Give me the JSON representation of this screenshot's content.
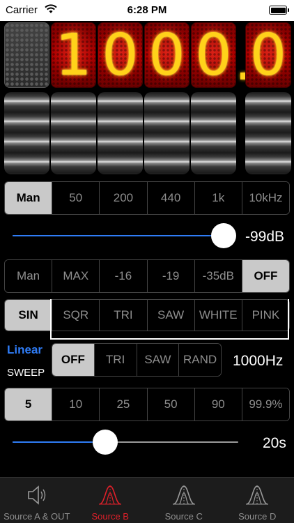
{
  "status": {
    "carrier": "Carrier",
    "time": "6:28 PM"
  },
  "display": {
    "digits": [
      "1",
      "0",
      "0",
      "0",
      "0"
    ]
  },
  "frequency_presets": [
    "Man",
    "50",
    "200",
    "440",
    "1k",
    "10kHz"
  ],
  "frequency_selected": 0,
  "level_slider": {
    "value_fraction": 0.99,
    "readout": "-99dB"
  },
  "level_presets": [
    "Man",
    "MAX",
    "-16",
    "-19",
    "-35dB",
    "OFF"
  ],
  "level_selected": 5,
  "waveforms": [
    "SIN",
    "SQR",
    "TRI",
    "SAW",
    "WHITE",
    "PINK"
  ],
  "waveform_selected": 0,
  "sweep": {
    "mode_label": "Linear",
    "label": "SWEEP",
    "options": [
      "OFF",
      "TRI",
      "SAW",
      "RAND"
    ],
    "selected": 0,
    "frequency_readout": "1000Hz"
  },
  "duration_presets": [
    "5",
    "10",
    "25",
    "50",
    "90",
    "99.9%"
  ],
  "duration_selected": 0,
  "time_slider": {
    "value_fraction": 0.41,
    "readout": "20s"
  },
  "tabs": [
    {
      "label": "Source A & OUT",
      "icon": "speaker-icon"
    },
    {
      "label": "Source B",
      "icon": "waveform-icon"
    },
    {
      "label": "Source C",
      "icon": "waveform-icon"
    },
    {
      "label": "Source D",
      "icon": "waveform-icon"
    }
  ],
  "active_tab": 1,
  "colors": {
    "accent": "#2f7cf6",
    "active_tab": "#e0202a",
    "digit": "#ffd21a"
  }
}
